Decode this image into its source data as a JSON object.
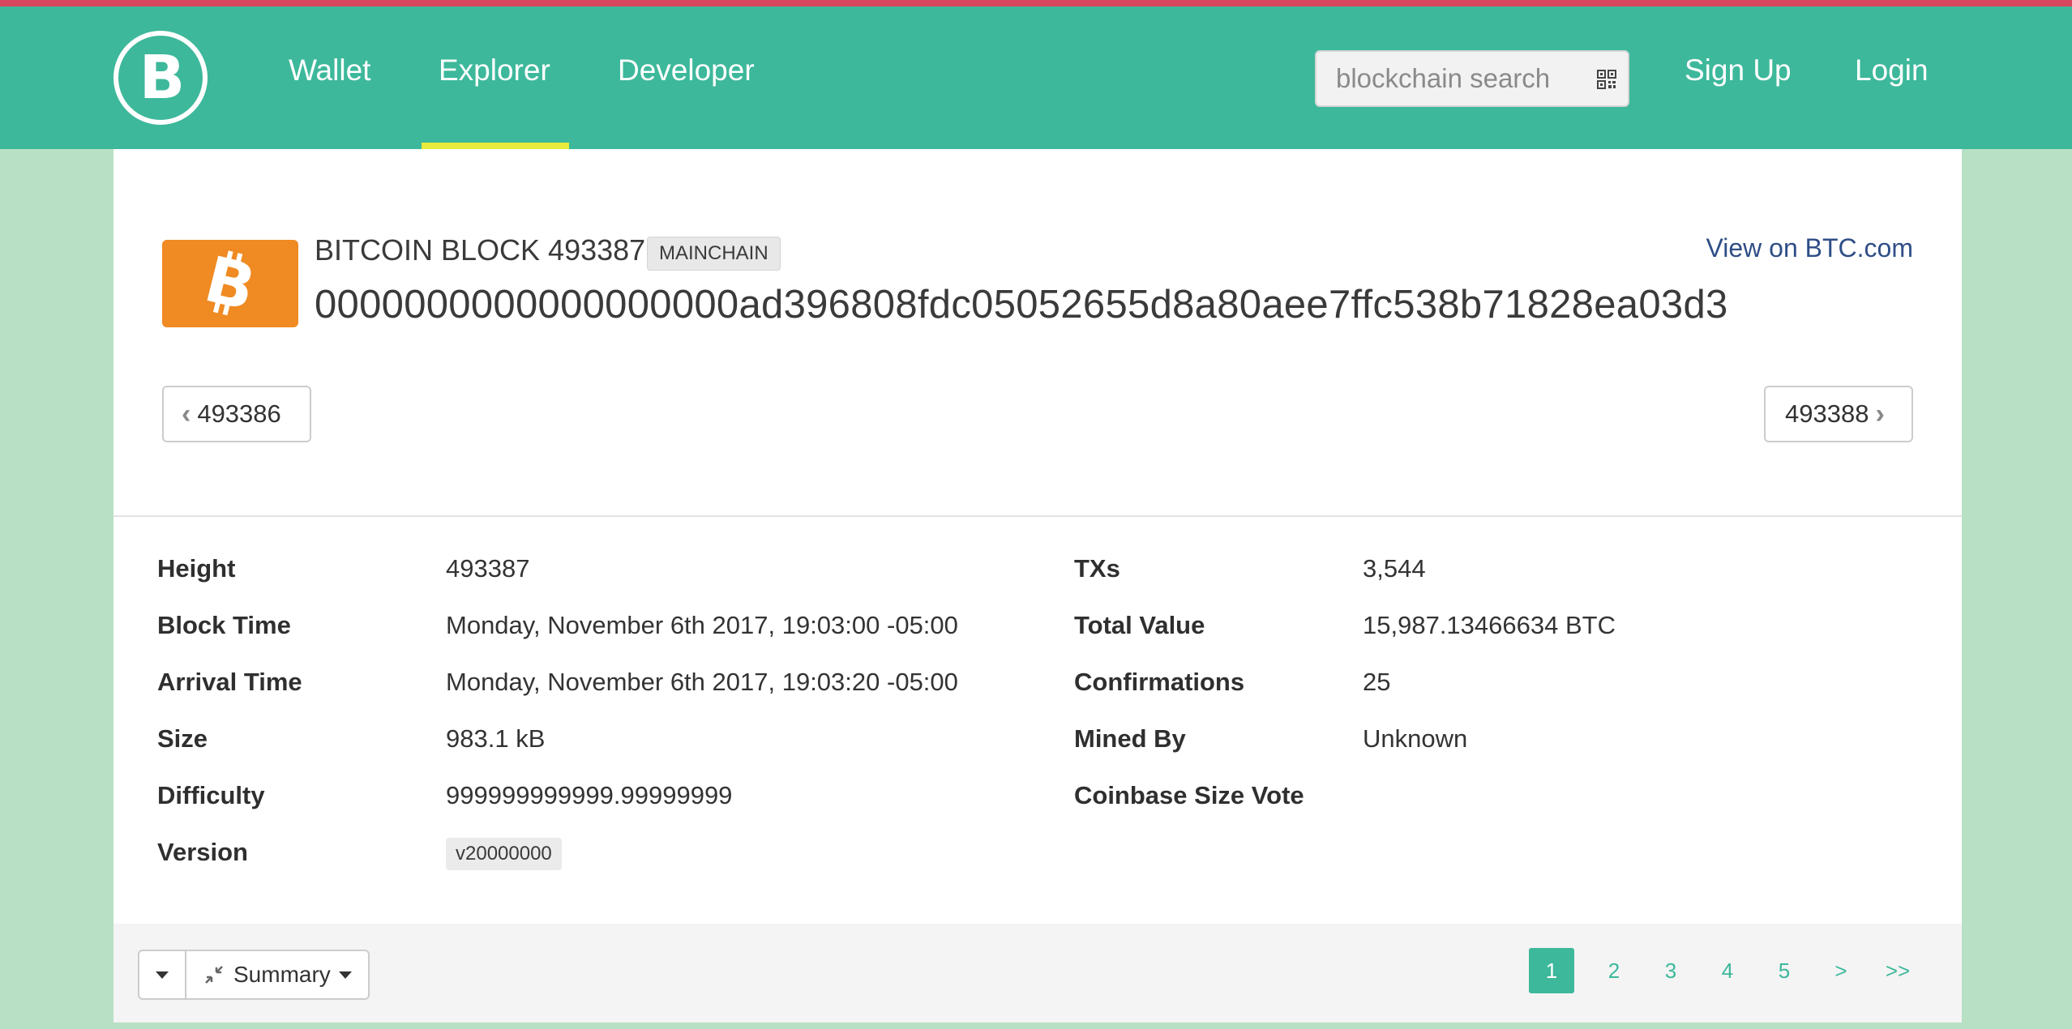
{
  "colors": {
    "brand": "#3db89b",
    "accent_underline": "#e8eb3b",
    "bitcoin_orange": "#f08a22",
    "link": "#2f4e86",
    "page_bg": "#b8e0c4"
  },
  "navbar": {
    "logo_letter": "B",
    "links": [
      "Wallet",
      "Explorer",
      "Developer"
    ],
    "active_link": "Explorer",
    "search": {
      "placeholder": "blockchain search",
      "icon": "qr-code-icon"
    },
    "sign_up": "Sign Up",
    "login": "Login"
  },
  "block": {
    "coin_icon": "bitcoin-icon",
    "title": "BITCOIN BLOCK 493387",
    "chain_badge": "MAINCHAIN",
    "hash": "0000000000000000000ad396808fdc05052655d8a80aee7ffc538b71828ea03d3",
    "external_link": "View on BTC.com",
    "prev_block": "493386",
    "next_block": "493388"
  },
  "details": {
    "left": [
      {
        "label": "Height",
        "value": "493387"
      },
      {
        "label": "Block Time",
        "value": "Monday, November 6th 2017, 19:03:00 -05:00"
      },
      {
        "label": "Arrival Time",
        "value": "Monday, November 6th 2017, 19:03:20 -05:00"
      },
      {
        "label": "Size",
        "value": "983.1 kB"
      },
      {
        "label": "Difficulty",
        "value": "999999999999.99999999"
      },
      {
        "label": "Version",
        "value": "v20000000"
      }
    ],
    "right": [
      {
        "label": "TXs",
        "value": "3,544"
      },
      {
        "label": "Total Value",
        "value": "15,987.13466634 BTC"
      },
      {
        "label": "Confirmations",
        "value": "25"
      },
      {
        "label": "Mined By",
        "value": "Unknown"
      },
      {
        "label": "Coinbase Size Vote",
        "value": ""
      }
    ]
  },
  "footer": {
    "view_mode": "Summary",
    "pagination": [
      "1",
      "2",
      "3",
      "4",
      "5",
      ">",
      ">>"
    ],
    "current_page": "1"
  }
}
